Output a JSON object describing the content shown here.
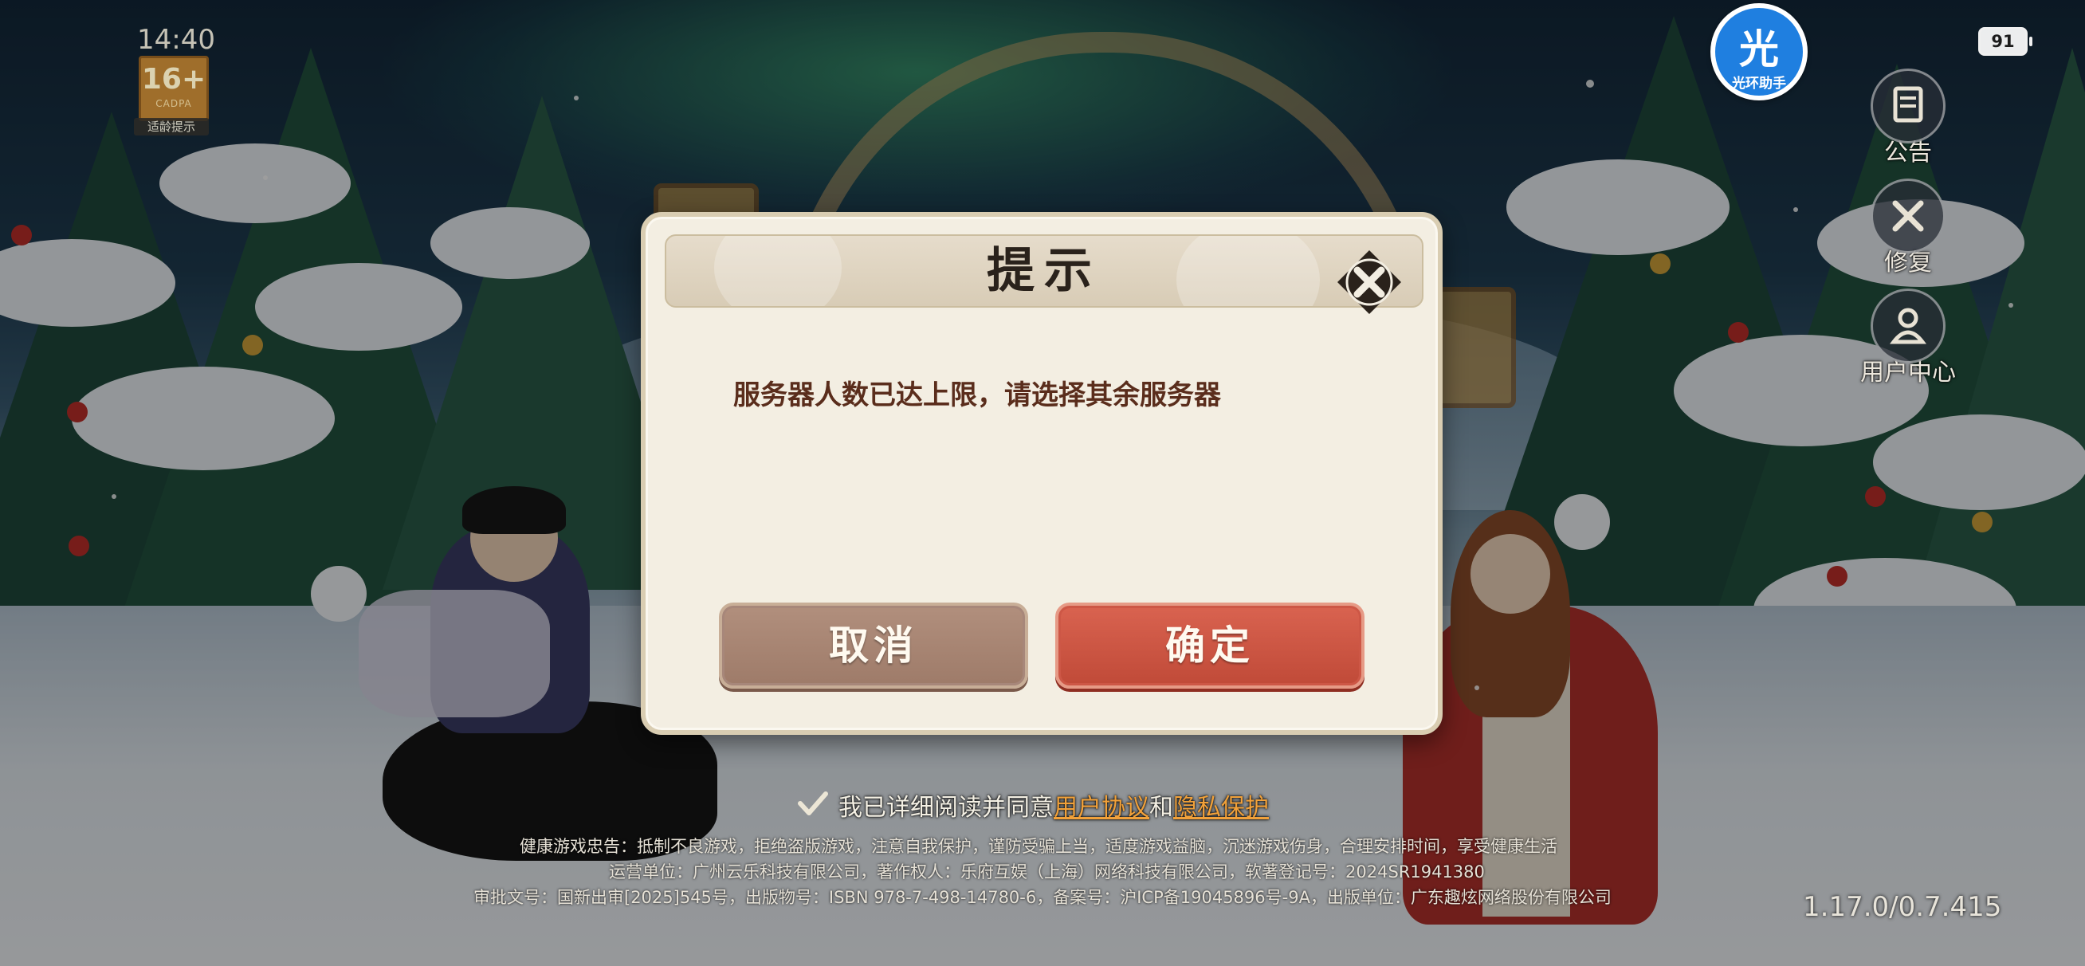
{
  "status_bar": {
    "time": "14:40",
    "battery": "91"
  },
  "age_rating": {
    "rating": "16+",
    "org": "CADPA",
    "label": "适龄提示"
  },
  "helper_app": {
    "glyph": "光",
    "label": "光环助手"
  },
  "side_menu": [
    {
      "label": "公告",
      "icon": "notice-icon"
    },
    {
      "label": "修复",
      "icon": "repair-icon"
    },
    {
      "label": "用户中心",
      "icon": "user-center-icon"
    }
  ],
  "dialog": {
    "title": "提示",
    "message": "服务器人数已达上限，请选择其余服务器",
    "cancel_label": "取消",
    "confirm_label": "确定"
  },
  "agreement": {
    "prefix": "我已详细阅读并同意",
    "user_agreement": "用户协议",
    "and": "和",
    "privacy": "隐私保护"
  },
  "legal": {
    "line1": "健康游戏忠告：抵制不良游戏，拒绝盗版游戏，注意自我保护，谨防受骗上当，适度游戏益脑，沉迷游戏伤身，合理安排时间，享受健康生活",
    "line2": "运营单位：广州云乐科技有限公司，著作权人：乐府互娱（上海）网络科技有限公司，软著登记号：2024SR1941380",
    "line3": "审批文号：国新出审[2025]545号，出版物号：ISBN 978-7-498-14780-6，备案号：沪ICP备19045896号-9A，出版单位：广东趣炫网络股份有限公司"
  },
  "version": "1.17.0/0.7.415",
  "colors": {
    "confirm": "#c9503e",
    "cancel": "#a8866f",
    "link": "#f1a13a",
    "dialog_bg": "#f3eee2"
  }
}
